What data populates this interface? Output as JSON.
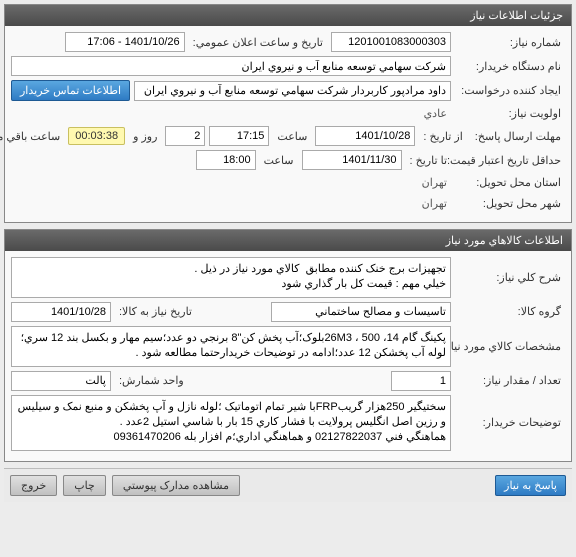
{
  "panel1": {
    "title": "جزئيات اطلاعات نياز",
    "need_no_label": "شماره نياز:",
    "need_no": "1201001083000303",
    "announce_label": "تاريخ و ساعت اعلان عمومي:",
    "announce": "1401/10/26 - 17:06",
    "buyer_label": "نام دستگاه خريدار:",
    "buyer": "شرکت سهامي توسعه منابع آب و نيروي ايران",
    "requester_label": "ايجاد کننده درخواست:",
    "requester": "داود مرادپور کاربردار شرکت سهامي توسعه منابع آب و نيروي ايران",
    "contact_btn": "اطلاعات تماس خريدار",
    "priority_label": "اولويت نياز:",
    "priority": "عادي",
    "deadline_label": "مهلت ارسال پاسخ:",
    "from_label": "از تاريخ :",
    "deadline_date": "1401/10/28",
    "time_label": "ساعت",
    "deadline_time": "17:15",
    "days": "2",
    "days_label": "روز و",
    "countdown": "00:03:38",
    "remaining_label": "ساعت باقي مانده",
    "validity_label": "حداقل تاريخ اعتبار قيمت:",
    "until_label": "تا تاريخ :",
    "validity_date": "1401/11/30",
    "validity_time": "18:00",
    "delivery_province_label": "استان محل تحويل:",
    "delivery_province": "تهران",
    "delivery_city_label": "شهر محل تحويل:",
    "delivery_city": "تهران"
  },
  "panel2": {
    "title": "اطلاعات کالاهاي مورد نياز",
    "desc_label": "شرح کلي نياز:",
    "desc": "تجهيزات برج خنک کننده مطابق  کالاي مورد نياز در ذيل .\nخيلي مهم : قيمت کل بار گذاري شود",
    "group_label": "گروه کالا:",
    "group": "تاسيسات و مصالح ساختماني",
    "need_date_label": "تاريخ نياز به کالا:",
    "need_date": "1401/10/28",
    "spec_label": "مشخصات کالاي مورد نياز:",
    "spec": "پکينگ گام 14، 500 ، 26M3بلوک؛آب پخش کن\"8 برنجي دو عدد؛سيم مهار و بکسل بند 12 سري؛لوله آب پخشکن 12 عدد؛ادامه در توضيحات خريدارحتما مطالعه شود .",
    "qty_label": "تعداد / مقدار نياز:",
    "qty": "1",
    "unit_label": "واحد شمارش:",
    "unit": "پالت",
    "buyer_notes_label": "توضيحات خريدار:",
    "buyer_notes": "سختيگير 250هزار گريبFRPبا شير تمام اتوماتيک ؛لوله نازل و آپ پخشکن و منبع نمک و سيليس و رزين اصل انگليس پرولايت با فشار کاري 15 بار با شاسي استيل 2عدد .\nهماهنگي فني 02127822037 و هماهنگي اداري؛م افزار بله 09361470206"
  },
  "footer": {
    "answer_btn": "پاسخ به نياز",
    "attachments_btn": "مشاهده مدارک پيوستي",
    "print_btn": "چاپ",
    "exit_btn": "خروج"
  }
}
